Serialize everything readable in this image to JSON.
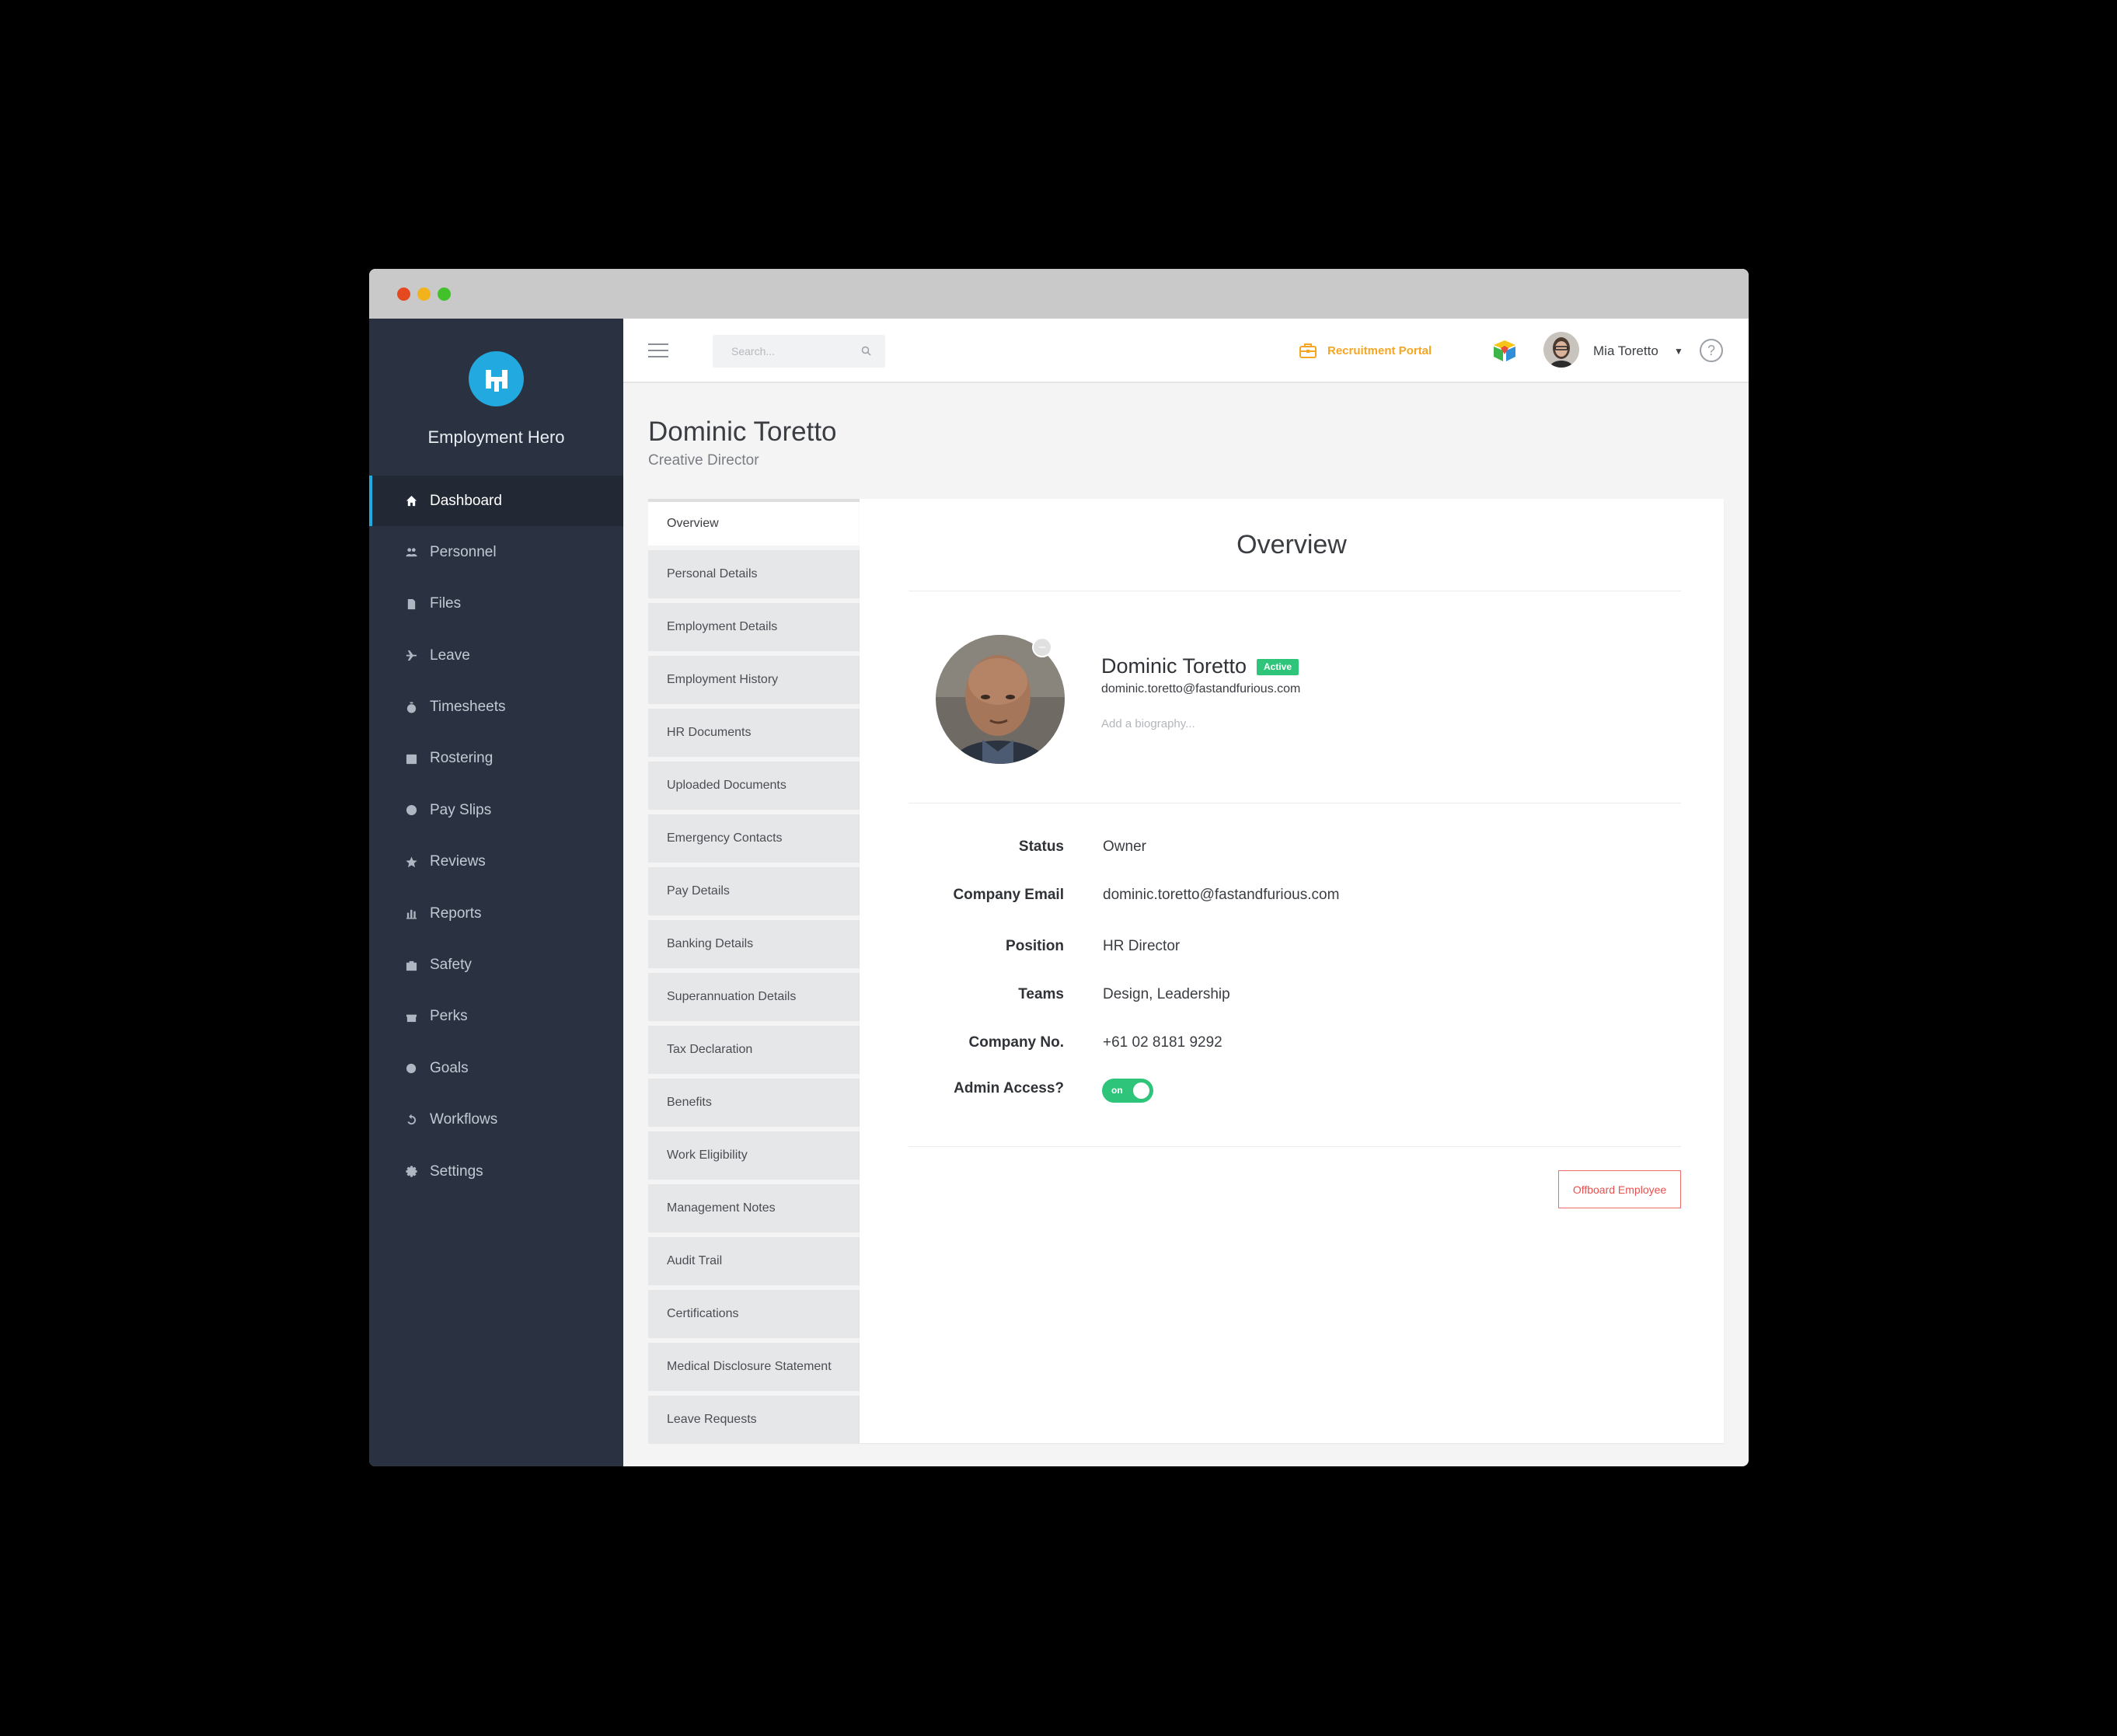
{
  "brand": {
    "name": "Employment Hero",
    "accent": "#21a9e0"
  },
  "sidebar": {
    "items": [
      {
        "label": "Dashboard",
        "icon": "home-icon",
        "active": true
      },
      {
        "label": "Personnel",
        "icon": "people-icon"
      },
      {
        "label": "Files",
        "icon": "file-icon"
      },
      {
        "label": "Leave",
        "icon": "plane-icon"
      },
      {
        "label": "Timesheets",
        "icon": "stopwatch-icon"
      },
      {
        "label": "Rostering",
        "icon": "calendar-icon"
      },
      {
        "label": "Pay Slips",
        "icon": "dollar-icon"
      },
      {
        "label": "Reviews",
        "icon": "star-icon"
      },
      {
        "label": "Reports",
        "icon": "bar-chart-icon"
      },
      {
        "label": "Safety",
        "icon": "first-aid-icon"
      },
      {
        "label": "Perks",
        "icon": "gift-icon"
      },
      {
        "label": "Goals",
        "icon": "target-icon"
      },
      {
        "label": "Workflows",
        "icon": "refresh-icon"
      },
      {
        "label": "Settings",
        "icon": "gear-icon"
      }
    ]
  },
  "topbar": {
    "search_placeholder": "Search...",
    "recruitment_label": "Recruitment Portal",
    "recruitment_color": "#f5a623",
    "user_name": "Mia Toretto",
    "help_label": "?"
  },
  "page": {
    "title": "Dominic Toretto",
    "subtitle": "Creative Director"
  },
  "tabs": [
    "Overview",
    "Personal Details",
    "Employment Details",
    "Employment History",
    "HR Documents",
    "Uploaded Documents",
    "Emergency Contacts",
    "Pay Details",
    "Banking Details",
    "Superannuation Details",
    "Tax Declaration",
    "Benefits",
    "Work Eligibility",
    "Management Notes",
    "Audit Trail",
    "Certifications",
    "Medical Disclosure Statement",
    "Leave Requests"
  ],
  "overview": {
    "heading": "Overview",
    "profile": {
      "name": "Dominic Toretto",
      "status_badge": "Active",
      "status_color": "#2ec47a",
      "email": "dominic.toretto@fastandfurious.com",
      "bio_placeholder": "Add a biography..."
    },
    "details": [
      {
        "label": "Status",
        "value": "Owner"
      },
      {
        "label": "Company Email",
        "value": "dominic.toretto@fastandfurious.com"
      },
      {
        "label": "Position",
        "value": "HR Director"
      },
      {
        "label": "Teams",
        "value": "Design, Leadership"
      },
      {
        "label": "Company No.",
        "value": "+61 02 8181 9292"
      }
    ],
    "admin_access": {
      "label": "Admin Access?",
      "toggle_text": "on",
      "enabled": true
    },
    "offboard_label": "Offboard Employee"
  }
}
